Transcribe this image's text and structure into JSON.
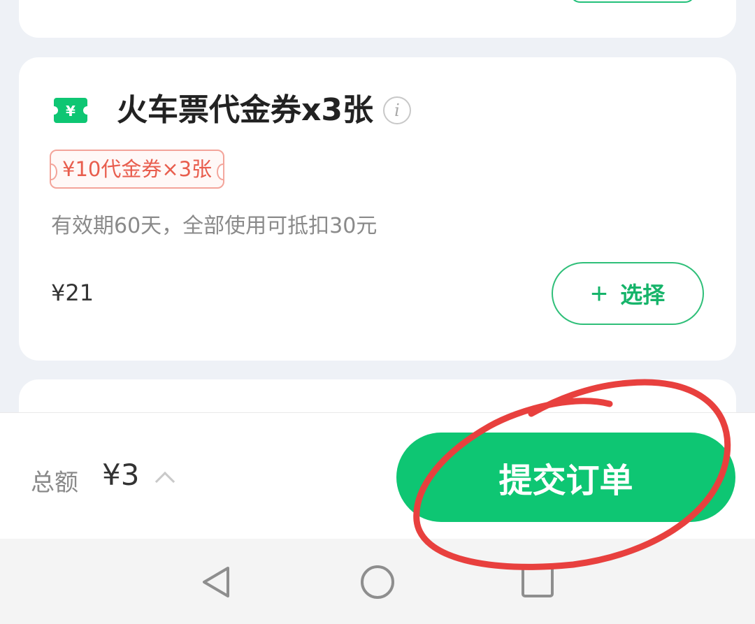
{
  "card": {
    "title": "火车票代金券x3张",
    "info_icon": "i",
    "ticket_icon_symbol": "¥",
    "tag": "¥10代金券×3张",
    "description": "有效期60天，全部使用可抵扣30元",
    "price": "¥21",
    "select_button": {
      "plus": "+",
      "label": "选择"
    }
  },
  "footer": {
    "total_label": "总额",
    "total_value": "¥3",
    "submit_label": "提交订单"
  },
  "colors": {
    "brand_green": "#0ec673",
    "tag_red": "#e85d4d",
    "annotation_red": "#e8403e"
  },
  "icons": [
    "ticket-icon",
    "info-icon",
    "plus-icon",
    "chevron-up-icon",
    "nav-back-icon",
    "nav-home-icon",
    "nav-recents-icon"
  ]
}
